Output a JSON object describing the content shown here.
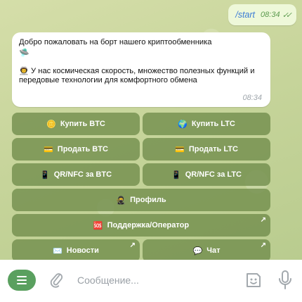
{
  "outgoing": {
    "text": "/start",
    "time": "08:34",
    "checks": "✓✓"
  },
  "incoming": {
    "line1": "Добро пожаловать на борт нашего криптообменника",
    "ufo": "🛸",
    "para2_icon": "👨‍🚀",
    "para2": "У нас космическая скорость, множество полезных функций и передовые технологии для комфортного обмена",
    "time": "08:34"
  },
  "keyboard": {
    "buy_btc": {
      "icon": "🪙",
      "label": "Купить BTC"
    },
    "buy_ltc": {
      "icon": "🌍",
      "label": "Купить LTC"
    },
    "sell_btc": {
      "icon": "💳",
      "label": "Продать BTC"
    },
    "sell_ltc": {
      "icon": "💳",
      "label": "Продать LTC"
    },
    "qr_btc": {
      "icon": "📱",
      "label": "QR/NFC за BTC"
    },
    "qr_ltc": {
      "icon": "📱",
      "label": "QR/NFC за LTC"
    },
    "profile": {
      "icon": "🥷",
      "label": "Профиль"
    },
    "support": {
      "icon": "🆘",
      "label": "Поддержка/Оператор"
    },
    "news": {
      "icon": "✉️",
      "label": "Новости"
    },
    "chat": {
      "icon": "💬",
      "label": "Чат"
    },
    "arrow": "↗"
  },
  "input": {
    "placeholder": "Сообщение..."
  },
  "icons": [
    "menu-icon",
    "paperclip-icon",
    "sticker-icon",
    "microphone-icon"
  ],
  "colors": {
    "menu_button": "#5aa05f",
    "keyboard_button": "#708c4a",
    "outgoing_bubble": "#eef8d9"
  }
}
